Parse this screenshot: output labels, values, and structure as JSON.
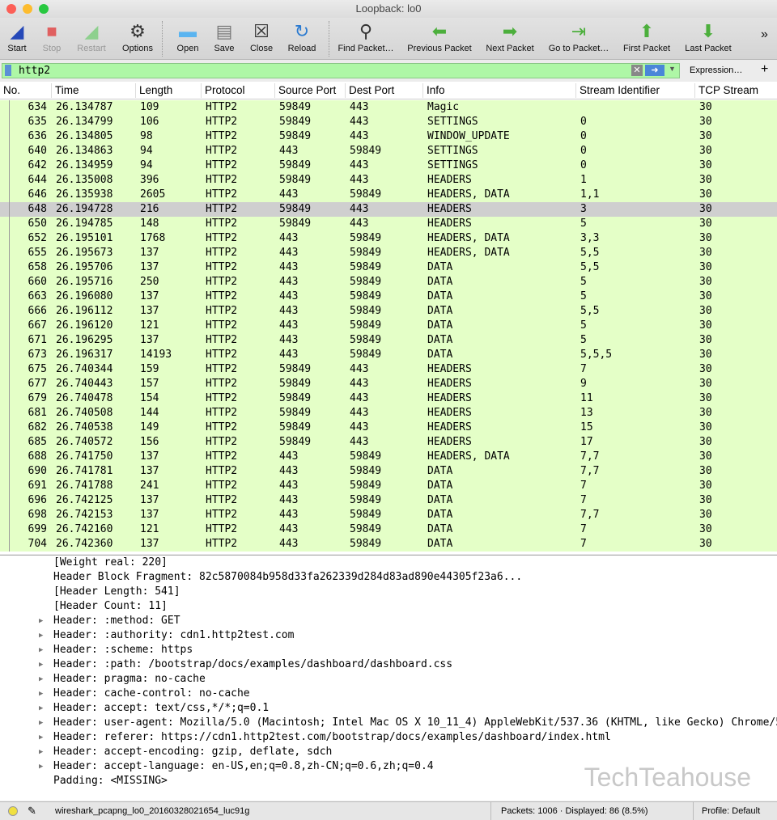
{
  "window": {
    "title": "Loopback: lo0"
  },
  "toolbar": {
    "items": [
      {
        "label": "Start",
        "icon": "shark-fin-icon",
        "enabled": true
      },
      {
        "label": "Stop",
        "icon": "stop-square-icon",
        "enabled": false
      },
      {
        "label": "Restart",
        "icon": "restart-fin-icon",
        "enabled": false
      },
      {
        "label": "Options",
        "icon": "gear-icon",
        "enabled": true
      },
      {
        "label": "Open",
        "icon": "folder-icon",
        "enabled": true
      },
      {
        "label": "Save",
        "icon": "save-file-icon",
        "enabled": true
      },
      {
        "label": "Close",
        "icon": "close-file-icon",
        "enabled": true
      },
      {
        "label": "Reload",
        "icon": "reload-icon",
        "enabled": true
      },
      {
        "label": "Find Packet…",
        "icon": "magnifier-icon",
        "enabled": true
      },
      {
        "label": "Previous Packet",
        "icon": "arrow-left-icon",
        "enabled": true
      },
      {
        "label": "Next Packet",
        "icon": "arrow-right-icon",
        "enabled": true
      },
      {
        "label": "Go to Packet…",
        "icon": "goto-icon",
        "enabled": true
      },
      {
        "label": "First Packet",
        "icon": "arrow-up-icon",
        "enabled": true
      },
      {
        "label": "Last Packet",
        "icon": "arrow-down-icon",
        "enabled": true
      }
    ],
    "overflow": "»"
  },
  "filter": {
    "value": "http2",
    "expression_label": "Expression…",
    "add_label": "+",
    "color": "#aef7a6"
  },
  "packet_list": {
    "columns": [
      "No.",
      "Time",
      "Length",
      "Protocol",
      "Source Port",
      "Dest Port",
      "Info",
      "Stream Identifier",
      "TCP Stream"
    ],
    "selected_no": "648",
    "rows": [
      [
        "634",
        "26.134787",
        "109",
        "HTTP2",
        "59849",
        "443",
        "Magic",
        "",
        "30"
      ],
      [
        "635",
        "26.134799",
        "106",
        "HTTP2",
        "59849",
        "443",
        "SETTINGS",
        "0",
        "30"
      ],
      [
        "636",
        "26.134805",
        "98",
        "HTTP2",
        "59849",
        "443",
        "WINDOW_UPDATE",
        "0",
        "30"
      ],
      [
        "640",
        "26.134863",
        "94",
        "HTTP2",
        "443",
        "59849",
        "SETTINGS",
        "0",
        "30"
      ],
      [
        "642",
        "26.134959",
        "94",
        "HTTP2",
        "59849",
        "443",
        "SETTINGS",
        "0",
        "30"
      ],
      [
        "644",
        "26.135008",
        "396",
        "HTTP2",
        "59849",
        "443",
        "HEADERS",
        "1",
        "30"
      ],
      [
        "646",
        "26.135938",
        "2605",
        "HTTP2",
        "443",
        "59849",
        "HEADERS, DATA",
        "1,1",
        "30"
      ],
      [
        "648",
        "26.194728",
        "216",
        "HTTP2",
        "59849",
        "443",
        "HEADERS",
        "3",
        "30"
      ],
      [
        "650",
        "26.194785",
        "148",
        "HTTP2",
        "59849",
        "443",
        "HEADERS",
        "5",
        "30"
      ],
      [
        "652",
        "26.195101",
        "1768",
        "HTTP2",
        "443",
        "59849",
        "HEADERS, DATA",
        "3,3",
        "30"
      ],
      [
        "655",
        "26.195673",
        "137",
        "HTTP2",
        "443",
        "59849",
        "HEADERS, DATA",
        "5,5",
        "30"
      ],
      [
        "658",
        "26.195706",
        "137",
        "HTTP2",
        "443",
        "59849",
        "DATA",
        "5,5",
        "30"
      ],
      [
        "660",
        "26.195716",
        "250",
        "HTTP2",
        "443",
        "59849",
        "DATA",
        "5",
        "30"
      ],
      [
        "663",
        "26.196080",
        "137",
        "HTTP2",
        "443",
        "59849",
        "DATA",
        "5",
        "30"
      ],
      [
        "666",
        "26.196112",
        "137",
        "HTTP2",
        "443",
        "59849",
        "DATA",
        "5,5",
        "30"
      ],
      [
        "667",
        "26.196120",
        "121",
        "HTTP2",
        "443",
        "59849",
        "DATA",
        "5",
        "30"
      ],
      [
        "671",
        "26.196295",
        "137",
        "HTTP2",
        "443",
        "59849",
        "DATA",
        "5",
        "30"
      ],
      [
        "673",
        "26.196317",
        "14193",
        "HTTP2",
        "443",
        "59849",
        "DATA",
        "5,5,5",
        "30"
      ],
      [
        "675",
        "26.740344",
        "159",
        "HTTP2",
        "59849",
        "443",
        "HEADERS",
        "7",
        "30"
      ],
      [
        "677",
        "26.740443",
        "157",
        "HTTP2",
        "59849",
        "443",
        "HEADERS",
        "9",
        "30"
      ],
      [
        "679",
        "26.740478",
        "154",
        "HTTP2",
        "59849",
        "443",
        "HEADERS",
        "11",
        "30"
      ],
      [
        "681",
        "26.740508",
        "144",
        "HTTP2",
        "59849",
        "443",
        "HEADERS",
        "13",
        "30"
      ],
      [
        "682",
        "26.740538",
        "149",
        "HTTP2",
        "59849",
        "443",
        "HEADERS",
        "15",
        "30"
      ],
      [
        "685",
        "26.740572",
        "156",
        "HTTP2",
        "59849",
        "443",
        "HEADERS",
        "17",
        "30"
      ],
      [
        "688",
        "26.741750",
        "137",
        "HTTP2",
        "443",
        "59849",
        "HEADERS, DATA",
        "7,7",
        "30"
      ],
      [
        "690",
        "26.741781",
        "137",
        "HTTP2",
        "443",
        "59849",
        "DATA",
        "7,7",
        "30"
      ],
      [
        "691",
        "26.741788",
        "241",
        "HTTP2",
        "443",
        "59849",
        "DATA",
        "7",
        "30"
      ],
      [
        "696",
        "26.742125",
        "137",
        "HTTP2",
        "443",
        "59849",
        "DATA",
        "7",
        "30"
      ],
      [
        "698",
        "26.742153",
        "137",
        "HTTP2",
        "443",
        "59849",
        "DATA",
        "7,7",
        "30"
      ],
      [
        "699",
        "26.742160",
        "121",
        "HTTP2",
        "443",
        "59849",
        "DATA",
        "7",
        "30"
      ],
      [
        "704",
        "26.742360",
        "137",
        "HTTP2",
        "443",
        "59849",
        "DATA",
        "7",
        "30"
      ]
    ]
  },
  "details": {
    "lines": [
      {
        "text": "[Weight real: 220]",
        "expandable": false
      },
      {
        "text": "Header Block Fragment: 82c5870084b958d33fa262339d284d83ad890e44305f23a6...",
        "expandable": false
      },
      {
        "text": "[Header Length: 541]",
        "expandable": false
      },
      {
        "text": "[Header Count: 11]",
        "expandable": false
      },
      {
        "text": "Header: :method: GET",
        "expandable": true
      },
      {
        "text": "Header: :authority: cdn1.http2test.com",
        "expandable": true
      },
      {
        "text": "Header: :scheme: https",
        "expandable": true
      },
      {
        "text": "Header: :path: /bootstrap/docs/examples/dashboard/dashboard.css",
        "expandable": true
      },
      {
        "text": "Header: pragma: no-cache",
        "expandable": true
      },
      {
        "text": "Header: cache-control: no-cache",
        "expandable": true
      },
      {
        "text": "Header: accept: text/css,*/*;q=0.1",
        "expandable": true
      },
      {
        "text": "Header: user-agent: Mozilla/5.0 (Macintosh; Intel Mac OS X 10_11_4) AppleWebKit/537.36 (KHTML, like Gecko) Chrome/5",
        "expandable": true
      },
      {
        "text": "Header: referer: https://cdn1.http2test.com/bootstrap/docs/examples/dashboard/index.html",
        "expandable": true
      },
      {
        "text": "Header: accept-encoding: gzip, deflate, sdch",
        "expandable": true
      },
      {
        "text": "Header: accept-language: en-US,en;q=0.8,zh-CN;q=0.6,zh;q=0.4",
        "expandable": true
      },
      {
        "text": "Padding: <MISSING>",
        "expandable": false
      }
    ],
    "watermark": "TechTeahouse"
  },
  "status": {
    "file": "wireshark_pcapng_lo0_20160328021654_luc91g",
    "packets": "Packets: 1006 · Displayed: 86 (8.5%)",
    "profile": "Profile: Default"
  }
}
